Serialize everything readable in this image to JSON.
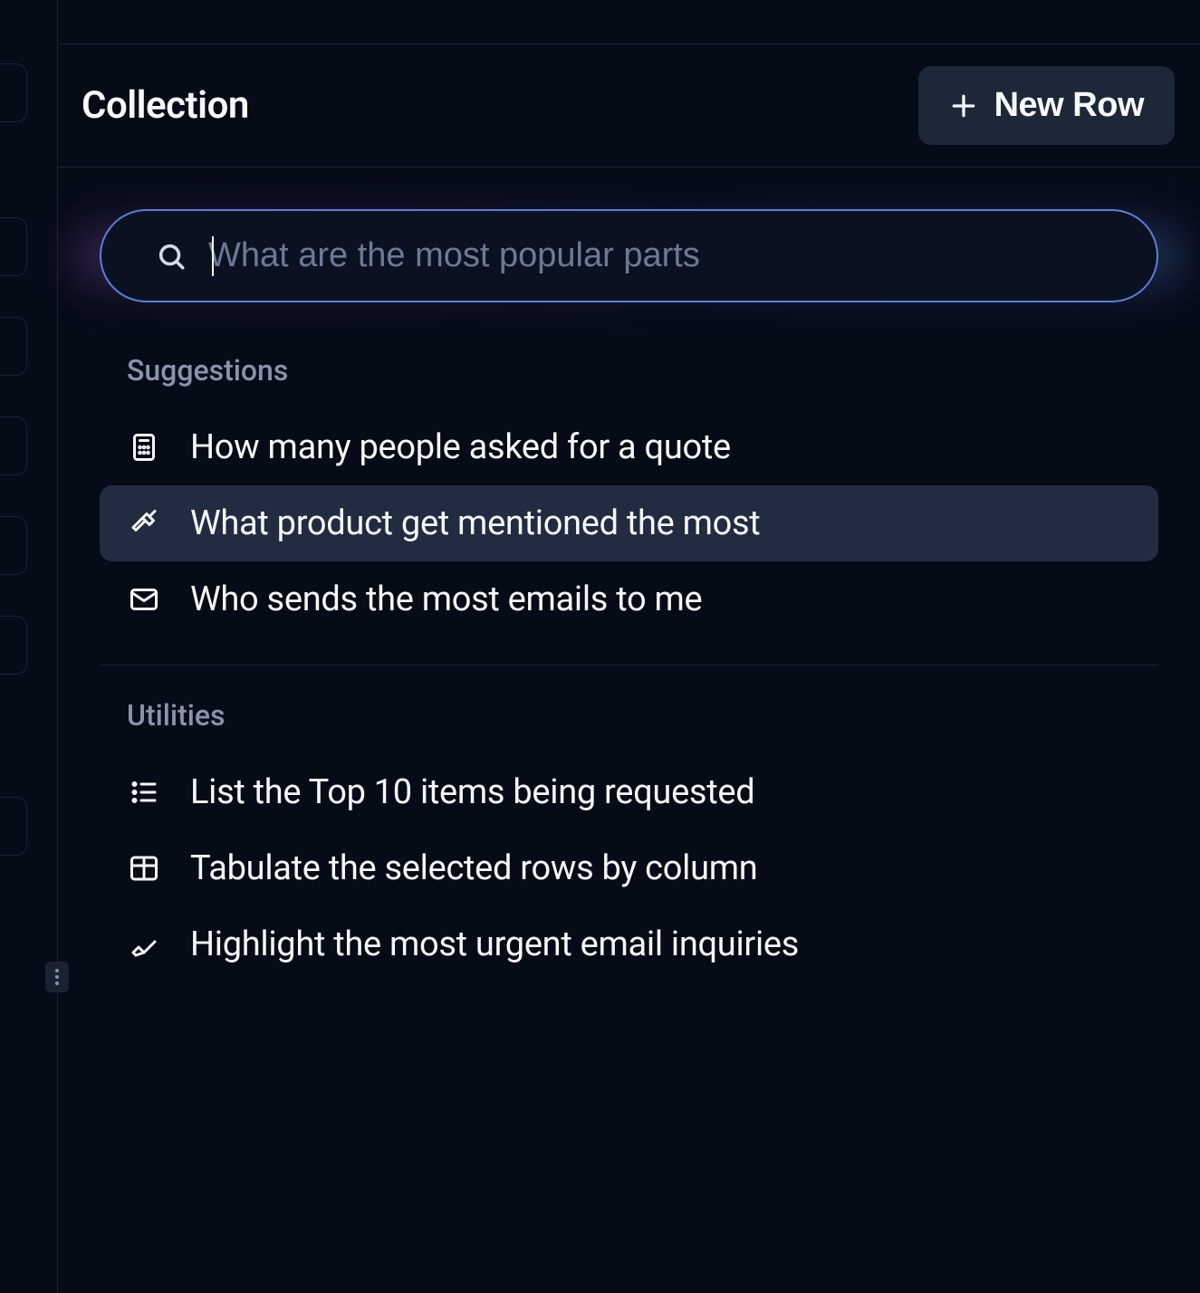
{
  "header": {
    "title": "Collection",
    "new_row_label": "New Row"
  },
  "search": {
    "placeholder": "What are the most popular parts",
    "value": ""
  },
  "sections": {
    "suggestions_label": "Suggestions",
    "utilities_label": "Utilities"
  },
  "suggestions": [
    {
      "icon": "calculator",
      "label": "How many people asked for a quote",
      "highlighted": false
    },
    {
      "icon": "hammer",
      "label": "What product get mentioned the most",
      "highlighted": true
    },
    {
      "icon": "mail",
      "label": "Who sends the most emails to me",
      "highlighted": false
    }
  ],
  "utilities": [
    {
      "icon": "list",
      "label": "List the Top 10 items being requested"
    },
    {
      "icon": "table",
      "label": "Tabulate the selected rows by column"
    },
    {
      "icon": "highlight",
      "label": "Highlight the most urgent email inquiries"
    }
  ]
}
